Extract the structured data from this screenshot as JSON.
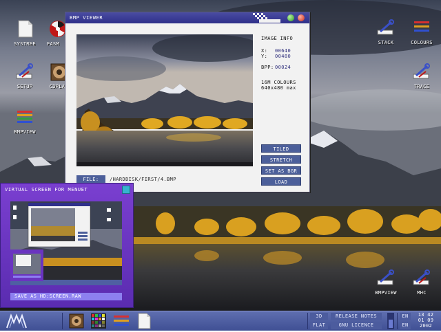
{
  "desktop": {
    "icons_left": [
      {
        "label": "SYSTREE",
        "icon": "document-icon"
      },
      {
        "label": "FASM",
        "icon": "radiation-icon"
      },
      {
        "label": "SETUP",
        "icon": "wrench-icon"
      },
      {
        "label": "CDPLA",
        "icon": "speaker-icon"
      },
      {
        "label": "BMPVIEW",
        "icon": "palette-icon"
      }
    ],
    "icons_right": [
      {
        "label": "STACK",
        "icon": "wrench-icon"
      },
      {
        "label": "COLOURS",
        "icon": "colour-bars-icon"
      },
      {
        "label": "TRACE",
        "icon": "wrench-icon"
      },
      {
        "label": "BMPVIEW",
        "icon": "wrench-icon"
      },
      {
        "label": "MHC",
        "icon": "wrench-icon"
      }
    ]
  },
  "bmp_viewer": {
    "title": "BMP VIEWER",
    "info": {
      "heading": "IMAGE INFO",
      "x_label": "X:",
      "x_value": "00640",
      "y_label": "Y:",
      "y_value": "00480",
      "bpp_label": "BPP:",
      "bpp_value": "00024",
      "colours": "16M COLOURS",
      "max_size": "640x480 max"
    },
    "buttons": {
      "tiled": "TILED",
      "stretch": "STRETCH",
      "set_as_bgr": "SET AS BGR",
      "load": "LOAD"
    },
    "file_label": "FILE:",
    "file_path": "/HARDDISK/FIRST/4.BMP"
  },
  "virtual_screen": {
    "title": "VIRTUAL SCREEN FOR MENUET",
    "save_label": "SAVE AS HD:SCREEN.RAW"
  },
  "taskbar": {
    "mode_3d": "3D",
    "mode_flat": "FLAT",
    "release_notes": "RELEASE NOTES",
    "gnu_licence": "GNU LICENCE",
    "lang1": "EN",
    "lang2": "EN",
    "clock_time": "13 42",
    "clock_date": "01 09",
    "clock_year": "2002",
    "apps": [
      "speaker-icon",
      "palette-grid-icon",
      "colour-bars-icon",
      "document-icon"
    ]
  },
  "colors": {
    "titlebar": "#2f308a",
    "button": "#4c5f9a",
    "virtual_screen": "#6a34c0",
    "taskbar": "#4f5fa2"
  }
}
